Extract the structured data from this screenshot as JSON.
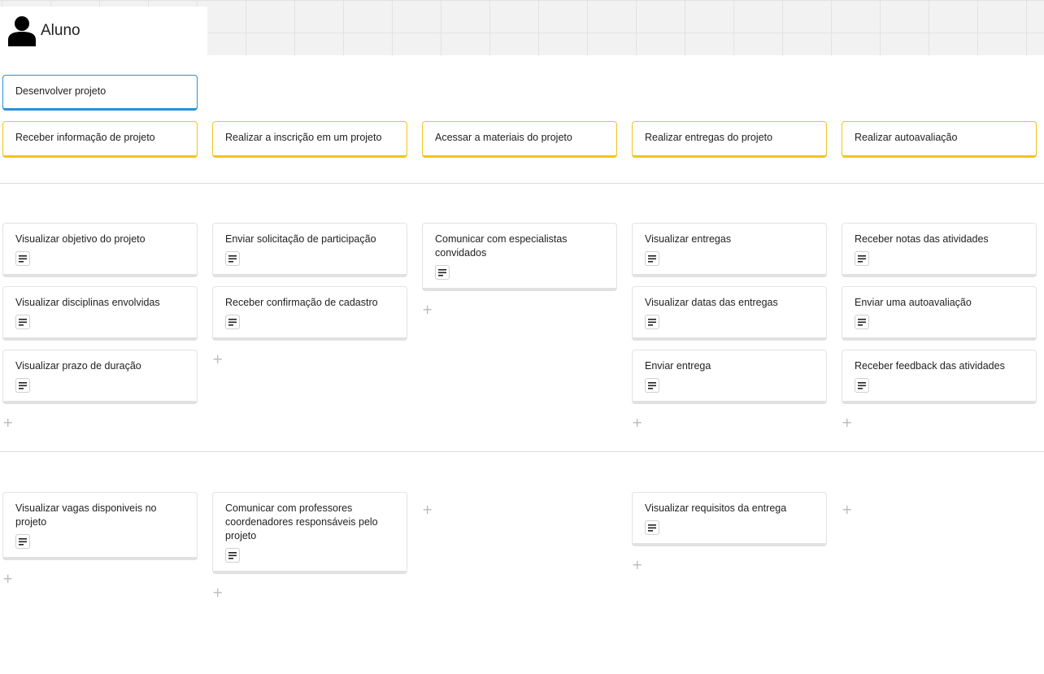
{
  "persona": {
    "name": "Aluno",
    "icon": "user-icon"
  },
  "activity": {
    "label": "Desenvolver projeto",
    "color": "#2b8fd6"
  },
  "steps": [
    {
      "label": "Receber informação de projeto"
    },
    {
      "label": "Realizar a inscrição em um projeto"
    },
    {
      "label": "Acessar a materiais do projeto"
    },
    {
      "label": "Realizar entregas do projeto"
    },
    {
      "label": "Realizar autoavaliação"
    }
  ],
  "step_color": "#f2c41c",
  "release1": [
    [
      "Visualizar objetivo do projeto",
      "Visualizar disciplinas envolvidas",
      "Visualizar prazo de duração"
    ],
    [
      "Enviar solicitação de participação",
      "Receber confirmação de cadastro"
    ],
    [
      "Comunicar com especialistas convidados"
    ],
    [
      "Visualizar entregas",
      "Visualizar datas das entregas",
      "Enviar entrega"
    ],
    [
      "Receber notas das atividades",
      "Enviar uma autoavaliação",
      "Receber feedback das atividades"
    ]
  ],
  "release2": [
    [
      "Visualizar vagas disponiveis no projeto"
    ],
    [
      "Comunicar com professores coordenadores responsáveis pelo projeto"
    ],
    [],
    [
      "Visualizar requisitos da entrega"
    ],
    []
  ],
  "add_symbol": "+"
}
